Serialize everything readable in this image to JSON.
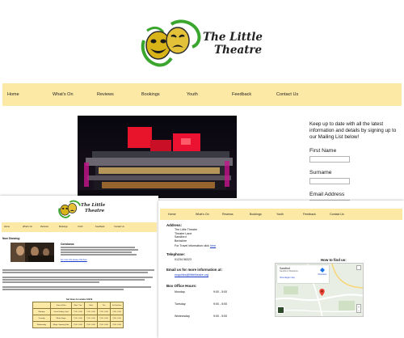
{
  "site": {
    "logo_line1": "The Little",
    "logo_line2": "Theatre"
  },
  "nav": {
    "items": [
      {
        "label": "Home"
      },
      {
        "label": "What's On"
      },
      {
        "label": "Reviews"
      },
      {
        "label": "Bookings"
      },
      {
        "label": "Youth"
      },
      {
        "label": "Feedback"
      },
      {
        "label": "Contact Us"
      }
    ]
  },
  "signup": {
    "text": "Keep up to date with all the latest information and details by signing up to our Mailing List below!",
    "first_name_label": "First Name",
    "surname_label": "Surname",
    "email_label": "Email Address"
  },
  "whats_on_page": {
    "heading": "Now Showing:",
    "show_title": "Coriolanus",
    "link_text": "For more info please click here",
    "table_caption": "Set times for weeks 1/3/19",
    "table": {
      "headers": [
        "",
        "Time of Film",
        "Mon / Tue",
        "Wed",
        "Thu",
        "Fri-Sat-Sun"
      ],
      "rows": [
        [
          "Monday",
          "Vesta Gallery Yard",
          "2:00 - 5:00",
          "2:00 - 5:00",
          "2:00 - 5:00",
          "2:00 - 5:00"
        ],
        [
          "Tuesday",
          "White Stage",
          "2:00 - 5:00",
          "2:00 - 5:00",
          "2:00 - 5:00",
          "2:00 - 5:00"
        ],
        [
          "Wednesday",
          "Magic Opening Film",
          "2:00 - 5:00",
          "2:00 - 5:00",
          "2:00 - 5:00",
          "2:00 - 5:00"
        ]
      ]
    }
  },
  "contact_page": {
    "address_heading": "Address:",
    "address_lines": [
      "The Little Theatre",
      "Theatre Lane",
      "Sandford",
      "Berkshire"
    ],
    "travel_text": "For Travel information click",
    "travel_link": "here",
    "telephone_heading": "Telephone:",
    "telephone_value": "01234 56323",
    "email_heading": "Email us for more information at:",
    "email_value": "enquiries@littletheatre.org",
    "hours_heading": "Box Office Hours:",
    "hours": [
      {
        "day": "Monday",
        "time": "9:00 - 5:00"
      },
      {
        "day": "Tuesday",
        "time": "9:00 - 5:00"
      },
      {
        "day": "Wednesday",
        "time": "9:00 - 5:00"
      }
    ],
    "map_title": "How to find us:",
    "map_place": "Sandford",
    "map_place_sub": "Sandford, Berkshire",
    "map_larger_link": "View larger map",
    "map_directions": "Directions"
  },
  "colors": {
    "nav_bg": "#fde9a6",
    "mask_green": "#3aa62e",
    "mask_gold": "#d8b418",
    "hero_red": "#e8142c",
    "link_blue": "#1a3cc8"
  },
  "icons": {
    "logo": "theatre-masks-icon",
    "map_pin": "map-pin-icon",
    "fullscreen": "fullscreen-icon",
    "zoom": "zoom-controls-icon"
  }
}
